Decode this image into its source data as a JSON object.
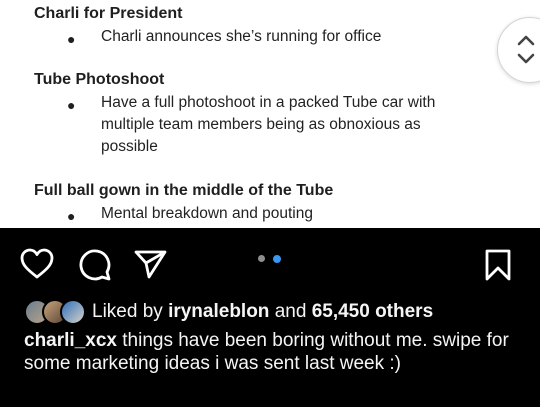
{
  "document": {
    "sections": [
      {
        "title": "Charli for President",
        "bullets": [
          "Charli announces she’s running for office"
        ]
      },
      {
        "title": "Tube Photoshoot",
        "bullets": [
          "Have a full photoshoot in a packed Tube car with multiple team members being as obnoxious as possible"
        ]
      },
      {
        "title": "Full ball gown in the middle of the Tube",
        "bullets": [
          "Mental breakdown and pouting"
        ]
      }
    ],
    "bullet_glyph": "●"
  },
  "post": {
    "carousel": {
      "total": 2,
      "active": 2
    },
    "likes": {
      "prefix": "Liked by",
      "user": "irynaleblon",
      "connector": "and",
      "others": "65,450 others"
    },
    "caption": {
      "username": "charli_xcx",
      "text": "things have been boring without me. swipe for some marketing ideas i was sent last week :)"
    },
    "icons": [
      "heart-icon",
      "comment-icon",
      "share-icon",
      "bookmark-icon"
    ],
    "colors": {
      "background": "#000000",
      "text": "#f5f5f5",
      "dot_active": "#3897f0",
      "dot_inactive": "#8e8e8e"
    }
  }
}
